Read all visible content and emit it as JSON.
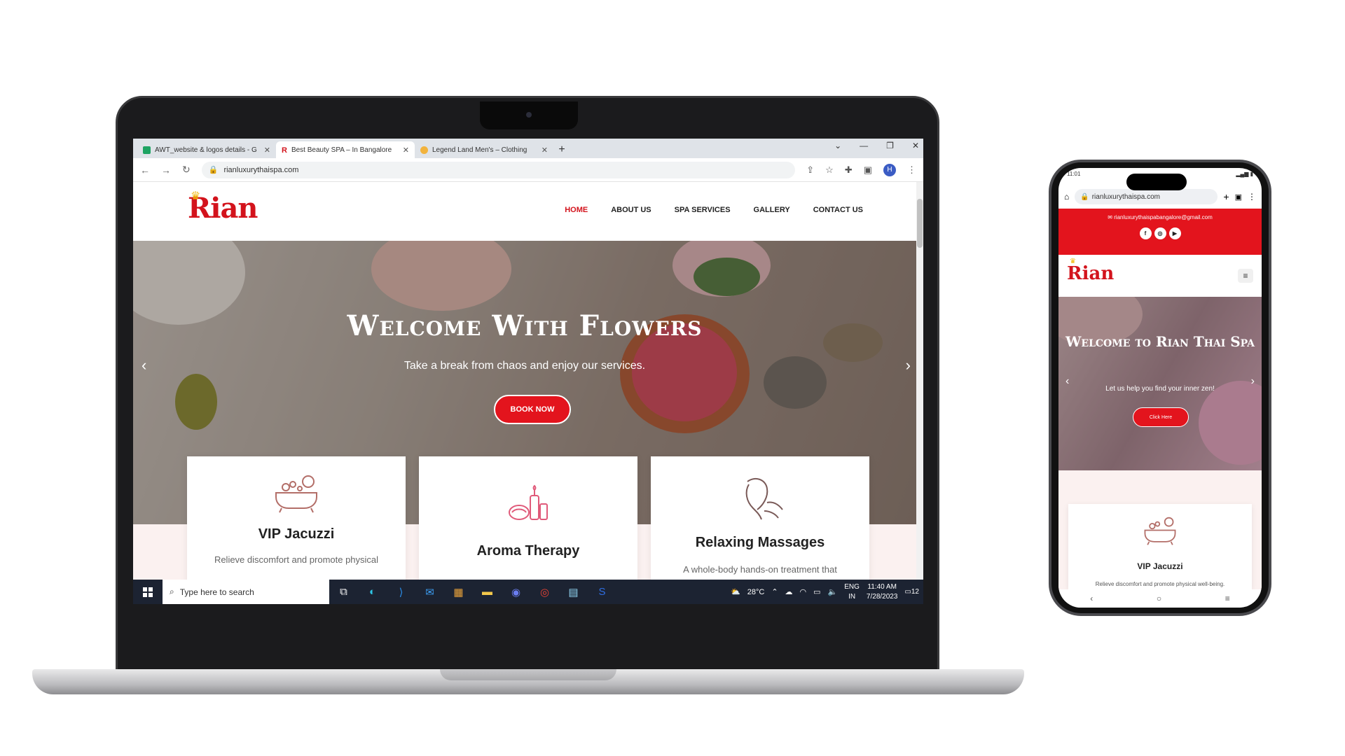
{
  "browser": {
    "tabs": [
      {
        "label": "AWT_website & logos details - G",
        "icon": "sheets-icon",
        "active": false
      },
      {
        "label": "Best Beauty SPA – In Bangalore",
        "icon": "rian-favicon",
        "active": true
      },
      {
        "label": "Legend Land Men's – Clothing",
        "icon": "legend-favicon",
        "active": false
      }
    ],
    "url": "rianluxurythaispa.com",
    "profile_initial": "H"
  },
  "site": {
    "logo_text": "Rian",
    "menu": [
      "HOME",
      "ABOUT US",
      "SPA SERVICES",
      "GALLERY",
      "CONTACT US"
    ],
    "hero": {
      "title": "Welcome With Flowers",
      "subtitle": "Take a break from chaos and enjoy our services.",
      "button": "BOOK NOW"
    },
    "cards": [
      {
        "title": "VIP Jacuzzi",
        "text": "Relieve discomfort and promote physical",
        "icon": "bathtub-icon"
      },
      {
        "title": "Aroma Therapy",
        "text": "",
        "icon": "aroma-candles-icon"
      },
      {
        "title": "Relaxing Massages",
        "text": "A whole-body hands-on treatment that",
        "icon": "massage-face-icon"
      }
    ]
  },
  "taskbar": {
    "search_placeholder": "Type here to search",
    "weather": "28°C",
    "lang_top": "ENG",
    "lang_bottom": "IN",
    "time": "11:40 AM",
    "date": "7/28/2023",
    "notifications": "12"
  },
  "phone": {
    "status_time": "11:01",
    "url": "rianluxurythaispa.com",
    "email": "rianluxurythaispabangalore@gmail.com",
    "logo_text": "Rian",
    "hero": {
      "title": "Welcome to Rian Thai Spa",
      "subtitle": "Let us help you find your inner zen!",
      "button": "Click Here"
    },
    "card": {
      "title": "VIP Jacuzzi",
      "text": "Relieve discomfort and promote physical well-being."
    }
  },
  "colors": {
    "brand_red": "#e3141d",
    "logo_red": "#d3131c",
    "pink_bg": "#fbf1f0",
    "taskbar": "#1c2332"
  }
}
